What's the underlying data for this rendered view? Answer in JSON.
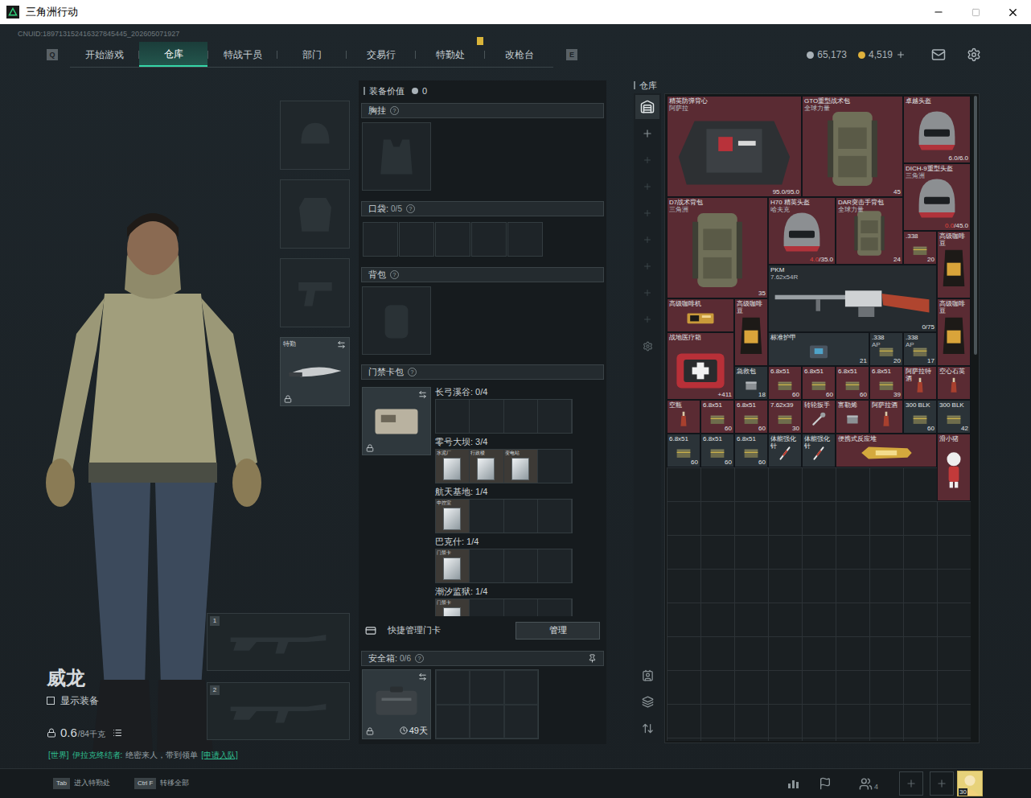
{
  "window": {
    "title": "三角洲行动"
  },
  "uid": "CNUID:189713152416327845445_202605071927",
  "help_mark": "?",
  "nav": {
    "prev_key": "Q",
    "next_key": "E",
    "tabs": [
      {
        "label": "开始游戏",
        "selected": false,
        "badge": false
      },
      {
        "label": "仓库",
        "selected": true,
        "badge": false
      },
      {
        "label": "特战干员",
        "selected": false,
        "badge": false
      },
      {
        "label": "部门",
        "selected": false,
        "badge": false
      },
      {
        "label": "交易行",
        "selected": false,
        "badge": false
      },
      {
        "label": "特勤处",
        "selected": false,
        "badge": true
      },
      {
        "label": "改枪台",
        "selected": false,
        "badge": false
      }
    ]
  },
  "currencies": [
    {
      "value": "65,173",
      "color": "#a9b2b8"
    },
    {
      "value": "4,519",
      "color": "#e0b23c"
    }
  ],
  "operator": {
    "name": "威龙",
    "show_equipment": {
      "label": "显示装备",
      "checked": false
    },
    "weight": "0.6",
    "weight_max": "/84千克"
  },
  "chat": {
    "channel": "[世界]",
    "sender": "伊拉克终结者:",
    "message": "绝密来人，带到领单",
    "action": "[申请入队]"
  },
  "slots": {
    "melee": {
      "label": "特勤",
      "locked": true
    },
    "weapons": [
      {
        "index": "1"
      },
      {
        "index": "2"
      }
    ]
  },
  "loadout": {
    "value_label": "装备价值",
    "value": "0",
    "chest": {
      "label": "胸挂"
    },
    "pockets": {
      "label": "口袋:",
      "count": "0/5",
      "slots": 5
    },
    "backpack": {
      "label": "背包"
    },
    "keycards": {
      "label": "门禁卡包",
      "locked": true,
      "capacity": 4,
      "maps": [
        {
          "name": "长弓溪谷: 0/4",
          "cards": []
        },
        {
          "name": "零号大坝: 3/4",
          "cards": [
            "水泥厂",
            "行政楼",
            "变电站"
          ]
        },
        {
          "name": "航天基地: 1/4",
          "cards": [
            "中控室"
          ]
        },
        {
          "name": "巴克什: 1/4",
          "cards": [
            "门禁卡"
          ]
        },
        {
          "name": "潮汐监狱: 1/4",
          "cards": [
            "门禁卡"
          ]
        }
      ]
    },
    "quick_manage": {
      "label": "快捷管理门卡",
      "button": "管理"
    },
    "safe": {
      "label": "安全箱:",
      "count": "0/6",
      "time": "49天",
      "slots": 6,
      "locked": true
    }
  },
  "warehouse": {
    "title": "仓库",
    "items": [
      {
        "name": "精英防弹背心",
        "sub": "阿萨拉",
        "current": "95.0",
        "max": "/95.0",
        "low": false,
        "kind": "vest",
        "color": "#5a2b33"
      },
      {
        "name": "GTO重型战术包",
        "sub": "全球力量",
        "value": "45",
        "kind": "backpack",
        "color": "#5a2b33"
      },
      {
        "name": "卓越头盔",
        "current": "6.0",
        "max": "/6.0",
        "low": false,
        "kind": "helmet",
        "color": "#5a2b33"
      },
      {
        "name": "DICH-9重型头盔",
        "sub": "三角洲",
        "current": "0.0",
        "max": "/45.0",
        "low": true,
        "kind": "helmet",
        "color": "#5a2b33"
      },
      {
        "name": "D7战术背包",
        "sub": "三角洲",
        "value": "35",
        "kind": "backpack",
        "color": "#5a2b33"
      },
      {
        "name": "H70 精英头盔",
        "sub": "哈夫克",
        "current": "4.0",
        "max": "/35.0",
        "low": true,
        "kind": "helmet",
        "color": "#5a2b33"
      },
      {
        "name": "DAR突击手背包",
        "sub": "全球力量",
        "value": "24",
        "kind": "backpack",
        "color": "#5a2b33"
      },
      {
        "name": ".338",
        "value": "20",
        "kind": "ammo",
        "color": "#5a2b33"
      },
      {
        "name": "高级咖啡豆",
        "kind": "coffee",
        "color": "#5a2b33"
      },
      {
        "name": "PKM",
        "sub": "7.62x54R",
        "value": "0/75",
        "kind": "gun",
        "color": "#262c30"
      },
      {
        "name": "高级咖啡机",
        "kind": "machine",
        "color": "#5a2b33"
      },
      {
        "name": "高级咖啡豆",
        "kind": "coffee",
        "color": "#5a2b33"
      },
      {
        "name": "高级咖啡豆",
        "kind": "coffee",
        "color": "#5a2b33"
      },
      {
        "name": "战地医疗箱",
        "value": "+411",
        "kind": "medkit",
        "color": "#5a2b33"
      },
      {
        "name": "标准护甲",
        "value": "21",
        "kind": "armor",
        "color": "#2b3338"
      },
      {
        "name": ".338",
        "sub": "AP",
        "value": "20",
        "kind": "ammo",
        "color": "#2b3338"
      },
      {
        "name": ".338",
        "sub": "AP",
        "value": "17",
        "kind": "ammo",
        "color": "#2b3338"
      },
      {
        "name": "急救包",
        "value": "18",
        "kind": "box",
        "color": "#2b3338"
      },
      {
        "name": "6.8x51",
        "value": "60",
        "kind": "ammo",
        "color": "#5a2b33"
      },
      {
        "name": "6.8x51",
        "value": "60",
        "kind": "ammo",
        "color": "#5a2b33"
      },
      {
        "name": "6.8x51",
        "value": "60",
        "kind": "ammo",
        "color": "#5a2b33"
      },
      {
        "name": "6.8x51",
        "value": "39",
        "kind": "ammo",
        "color": "#5a2b33"
      },
      {
        "name": "阿萨拉特酒",
        "kind": "bottle",
        "color": "#5a2b33"
      },
      {
        "name": "空心石英",
        "kind": "bottle",
        "color": "#5a2b33"
      },
      {
        "name": "空瓶",
        "kind": "bottle",
        "color": "#5a2b33"
      },
      {
        "name": "6.8x51",
        "value": "60",
        "kind": "ammo",
        "color": "#5a2b33"
      },
      {
        "name": "6.8x51",
        "value": "60",
        "kind": "ammo",
        "color": "#5a2b33"
      },
      {
        "name": "7.62x39",
        "value": "30",
        "kind": "ammo",
        "color": "#5a2b33"
      },
      {
        "name": "转轮扳手",
        "kind": "tool",
        "color": "#5a2b33"
      },
      {
        "name": "富勒烯",
        "kind": "box",
        "color": "#5a2b33"
      },
      {
        "name": "阿萨拉酒",
        "kind": "bottle",
        "color": "#5a2b33"
      },
      {
        "name": "300 BLK",
        "value": "60",
        "kind": "ammo",
        "color": "#2b3338"
      },
      {
        "name": "300 BLK",
        "value": "42",
        "kind": "ammo",
        "color": "#2b3338"
      },
      {
        "name": "6.8x51",
        "value": "60",
        "kind": "ammo",
        "color": "#2b3338"
      },
      {
        "name": "6.8x51",
        "value": "60",
        "kind": "ammo",
        "color": "#2b3338"
      },
      {
        "name": "6.8x51",
        "value": "60",
        "kind": "ammo",
        "color": "#2b3338"
      },
      {
        "name": "体能强化针",
        "kind": "syringe",
        "color": "#2b3338"
      },
      {
        "name": "体能强化针",
        "kind": "syringe",
        "color": "#2b3338"
      },
      {
        "name": "便携式反应堆",
        "kind": "gold",
        "color": "#5a2b33"
      },
      {
        "name": "滑小猪",
        "kind": "figure",
        "color": "#5a2b33"
      }
    ]
  },
  "bottom_bar": {
    "hints": [
      {
        "key": "Tab",
        "label": "进入特勤处"
      },
      {
        "key": "Ctrl F",
        "label": "转移全部"
      }
    ],
    "friends": "4",
    "level": "30"
  }
}
